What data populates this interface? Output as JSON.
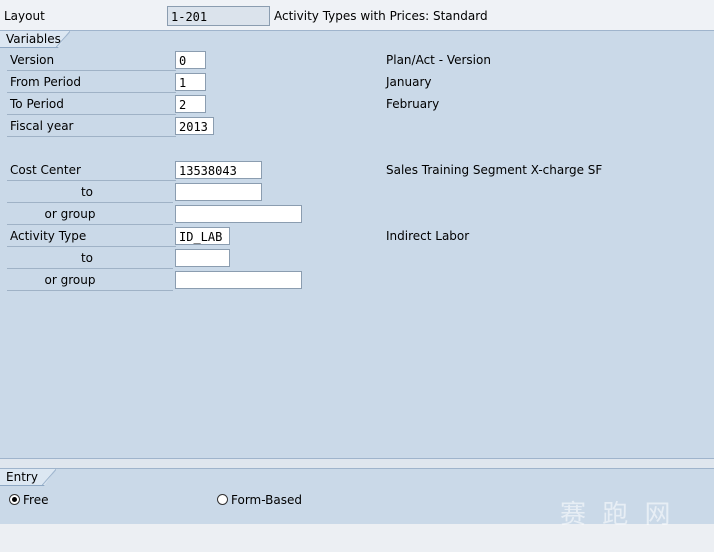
{
  "header": {
    "layout_label": "Layout",
    "layout_value": "1-201",
    "layout_description": "Activity Types with Prices: Standard"
  },
  "variables": {
    "section_title": "Variables",
    "version": {
      "label": "Version",
      "value": "0",
      "description": "Plan/Act - Version"
    },
    "from_period": {
      "label": "From Period",
      "value": "1",
      "description": "January"
    },
    "to_period": {
      "label": "To Period",
      "value": "2",
      "description": "February"
    },
    "fiscal_year": {
      "label": "Fiscal year",
      "value": "2013"
    },
    "cost_center": {
      "label": "Cost Center",
      "value": "13538043",
      "description": "Sales Training Segment X-charge SF"
    },
    "cost_center_to": {
      "label": "to",
      "value": ""
    },
    "cost_center_group": {
      "label": "or group",
      "value": ""
    },
    "activity_type": {
      "label": "Activity Type",
      "value": "ID_LAB",
      "description": "Indirect Labor"
    },
    "activity_type_to": {
      "label": "to",
      "value": ""
    },
    "activity_type_group": {
      "label": "or group",
      "value": ""
    }
  },
  "entry": {
    "section_title": "Entry",
    "options": [
      {
        "label": "Free",
        "selected": true
      },
      {
        "label": "Form-Based",
        "selected": false
      }
    ]
  },
  "watermark": {
    "text": "赛 跑 网"
  }
}
